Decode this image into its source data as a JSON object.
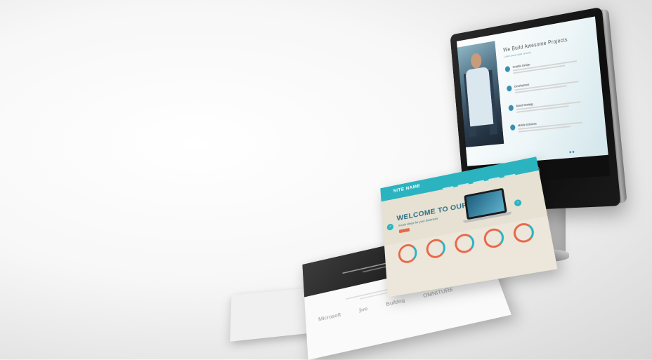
{
  "monitor_screen": {
    "heading": "We Build Awesome Projects",
    "subheading": "Lorem ipsum dolor sit amet",
    "features": [
      {
        "icon": "gear-icon",
        "title": "Graphic Design"
      },
      {
        "icon": "code-icon",
        "title": "Development"
      },
      {
        "icon": "globe-icon",
        "title": "Brand Strategy"
      },
      {
        "icon": "mobile-icon",
        "title": "Mobile Solutions"
      }
    ],
    "quote_icon": "❝"
  },
  "site_page": {
    "brand": "SITE NAME",
    "welcome": "WELCOME TO OUR SITE",
    "tagline": "Fresh Ideas for your Business",
    "prev_arrow": "‹",
    "next_arrow": "›"
  },
  "dark_page": {
    "client_logos": [
      "Microsoft",
      "jive",
      "Bulldog",
      "OMNITURE"
    ]
  },
  "colors": {
    "teal": "#2bb3c0",
    "accent_orange": "#e8674a",
    "monitor_bezel": "#111111"
  }
}
